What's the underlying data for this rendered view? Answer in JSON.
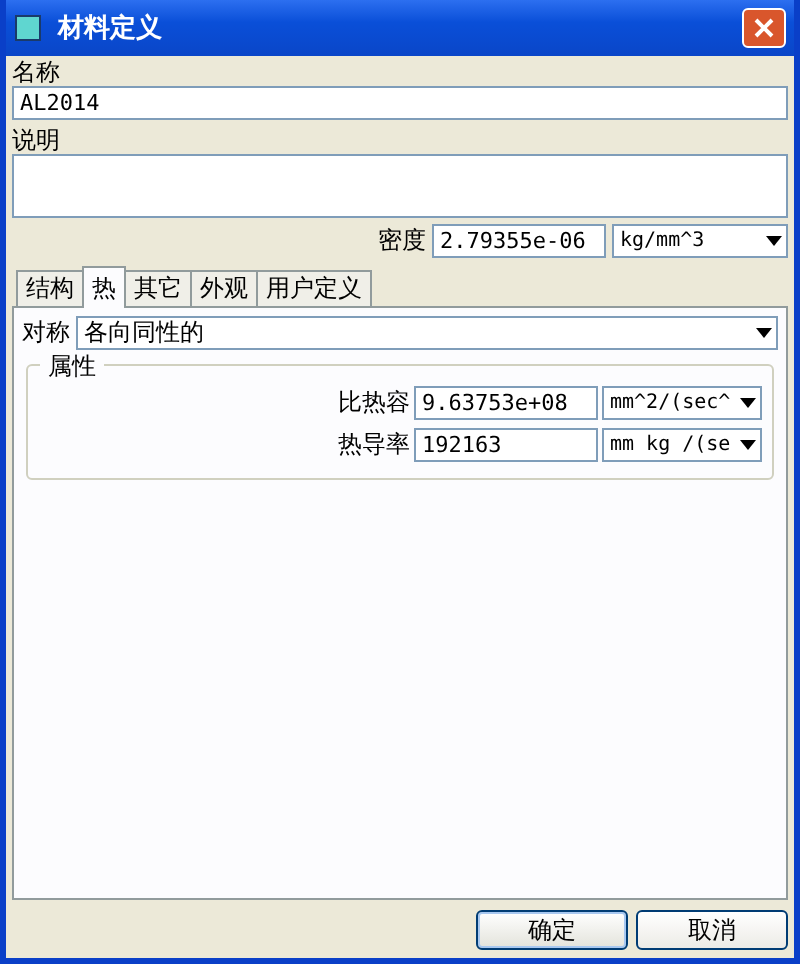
{
  "window": {
    "title": "材料定义"
  },
  "name": {
    "label": "名称",
    "value": "AL2014"
  },
  "description": {
    "label": "说明"
  },
  "density": {
    "label": "密度",
    "value": "2.79355e-06",
    "unit": "kg/mm^3"
  },
  "tabs": [
    {
      "label": "结构",
      "selected": false
    },
    {
      "label": "热",
      "selected": true
    },
    {
      "label": "其它",
      "selected": false
    },
    {
      "label": "外观",
      "selected": false
    },
    {
      "label": "用户定义",
      "selected": false
    }
  ],
  "symmetry": {
    "label": "对称",
    "value": "各向同性的"
  },
  "properties": {
    "title": "属性",
    "rows": [
      {
        "label": "比热容",
        "value": "9.63753e+08",
        "unit": "mm^2/(sec^"
      },
      {
        "label": "热导率",
        "value": "192163",
        "unit": "mm kg /(se"
      }
    ]
  },
  "buttons": [
    {
      "label": "确定",
      "kind": "primary"
    },
    {
      "label": "取消",
      "kind": "normal"
    }
  ]
}
